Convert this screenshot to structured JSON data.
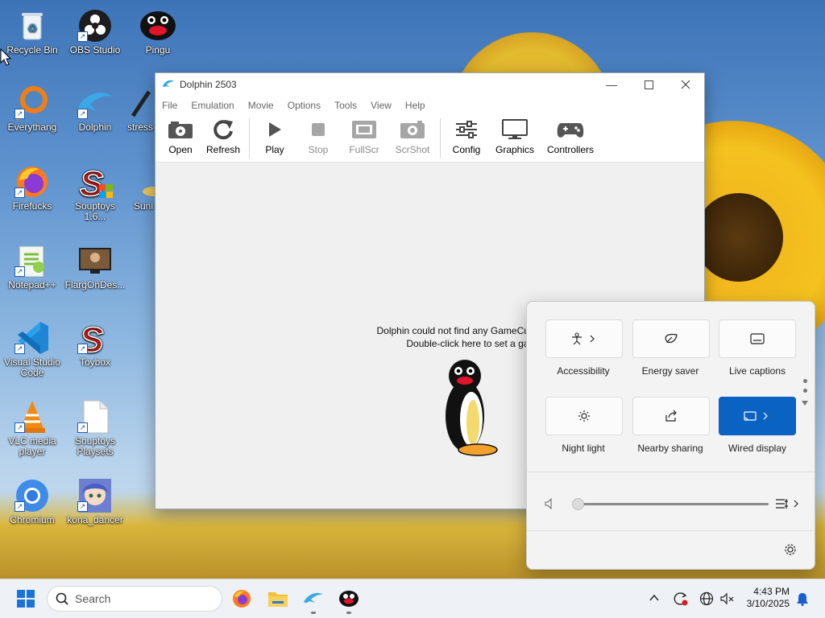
{
  "colors": {
    "accent": "#0a62c2",
    "taskbar": "#eef2f7",
    "window_bg": "#f0f0f0"
  },
  "desktop": {
    "icons": [
      {
        "label": "Recycle Bin",
        "icon": "recycle-bin-icon"
      },
      {
        "label": "OBS Studio",
        "icon": "obs-icon"
      },
      {
        "label": "Pingu",
        "icon": "pingu-icon"
      },
      {
        "label": "Everythang",
        "icon": "search-magnifier-icon"
      },
      {
        "label": "Dolphin",
        "icon": "dolphin-icon"
      },
      {
        "label": "stress-",
        "icon": "app-icon"
      },
      {
        "label": "Firefucks",
        "icon": "firefox-icon"
      },
      {
        "label": "Souptoys 1.6...",
        "icon": "souptoys-icon"
      },
      {
        "label": "Suni",
        "icon": "app-icon"
      },
      {
        "label": "Notepad++",
        "icon": "notepad-plus-icon"
      },
      {
        "label": "FlargOnDes...",
        "icon": "video-thumbnail-icon"
      },
      {
        "label": "Visual Studio Code",
        "icon": "vscode-icon"
      },
      {
        "label": "Toybox",
        "icon": "souptoys-icon"
      },
      {
        "label": "VLC media player",
        "icon": "vlc-icon"
      },
      {
        "label": "Souptoys Playsets",
        "icon": "document-icon"
      },
      {
        "label": "Chromium",
        "icon": "chromium-icon"
      },
      {
        "label": "kona_dancer",
        "icon": "anime-image-icon"
      }
    ]
  },
  "dolphin": {
    "title": "Dolphin 2503",
    "menu": [
      "File",
      "Emulation",
      "Movie",
      "Options",
      "Tools",
      "View",
      "Help"
    ],
    "toolbar": {
      "open": "Open",
      "refresh": "Refresh",
      "play": "Play",
      "stop": "Stop",
      "fullscr": "FullScr",
      "scrshot": "ScrShot",
      "config": "Config",
      "graphics": "Graphics",
      "controllers": "Controllers"
    },
    "empty_line1": "Dolphin could not find any GameCube/Wii ISOs or WADs.",
    "empty_line2": "Double-click here to set a games directory..."
  },
  "quick_settings": {
    "tiles": {
      "accessibility": "Accessibility",
      "energy_saver": "Energy saver",
      "live_captions": "Live captions",
      "night_light": "Night light",
      "nearby_sharing": "Nearby sharing",
      "wired_display": "Wired display"
    },
    "volume_level_percent": 0
  },
  "taskbar": {
    "search_placeholder": "Search",
    "time": "4:43 PM",
    "date": "3/10/2025"
  }
}
